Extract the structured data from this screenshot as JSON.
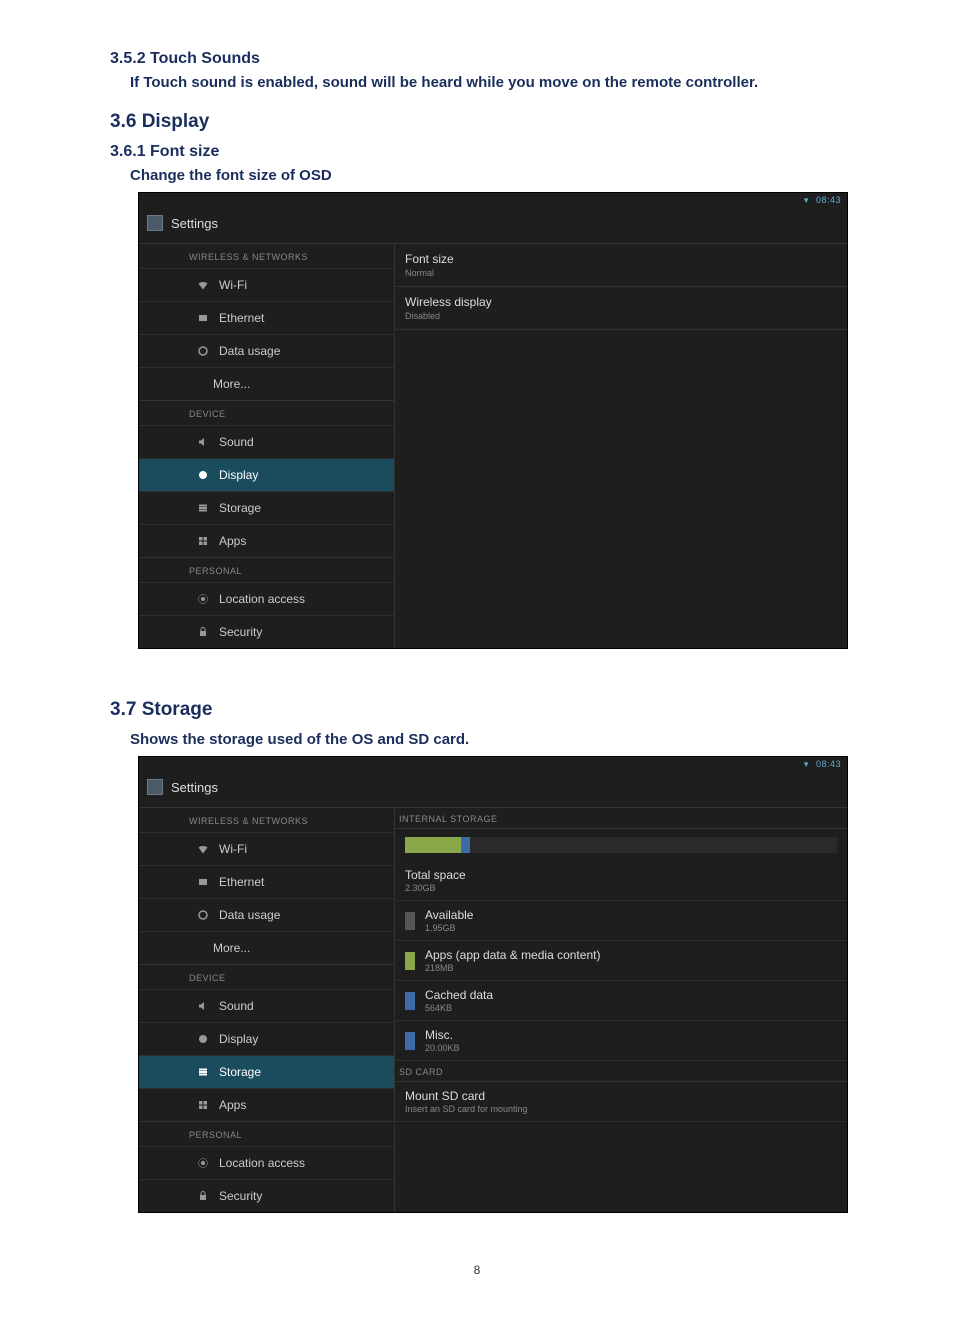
{
  "doc": {
    "h_352": "3.5.2 Touch Sounds",
    "body_352": "If Touch sound is enabled, sound will be heard while you move on the remote controller.",
    "h_36": "3.6 Display",
    "h_361": "3.6.1 Font size",
    "body_361": "Change the font size of OSD",
    "h_37": "3.7 Storage",
    "body_37": "Shows the storage used of the OS and SD card.",
    "page": "8"
  },
  "shot1": {
    "status_time": "08:43",
    "title": "Settings",
    "cats": {
      "wireless": "WIRELESS & NETWORKS",
      "device": "DEVICE",
      "personal": "PERSONAL"
    },
    "items": {
      "wifi": "Wi-Fi",
      "ethernet": "Ethernet",
      "data": "Data usage",
      "more": "More...",
      "sound": "Sound",
      "display": "Display",
      "storage": "Storage",
      "apps": "Apps",
      "location": "Location access",
      "security": "Security"
    },
    "detail": {
      "font_label": "Font size",
      "font_val": "Normal",
      "wd_label": "Wireless display",
      "wd_val": "Disabled"
    }
  },
  "shot2": {
    "status_time": "08:43",
    "title": "Settings",
    "cats": {
      "wireless": "WIRELESS & NETWORKS",
      "device": "DEVICE",
      "personal": "PERSONAL"
    },
    "items": {
      "wifi": "Wi-Fi",
      "ethernet": "Ethernet",
      "data": "Data usage",
      "more": "More...",
      "sound": "Sound",
      "display": "Display",
      "storage": "Storage",
      "apps": "Apps",
      "location": "Location access",
      "security": "Security"
    },
    "detail": {
      "cat_internal": "INTERNAL STORAGE",
      "total_label": "Total space",
      "total_val": "2.30GB",
      "avail_label": "Available",
      "avail_val": "1.95GB",
      "apps_label": "Apps (app data & media content)",
      "apps_val": "218MB",
      "cache_label": "Cached data",
      "cache_val": "564KB",
      "misc_label": "Misc.",
      "misc_val": "20.00KB",
      "cat_sd": "SD CARD",
      "mount_label": "Mount SD card",
      "mount_sub": "Insert an SD card for mounting"
    },
    "colors": {
      "apps": "#8aa84a",
      "cache": "#3f6aa8",
      "misc": "#3f6aa8",
      "avail": "#555"
    }
  }
}
